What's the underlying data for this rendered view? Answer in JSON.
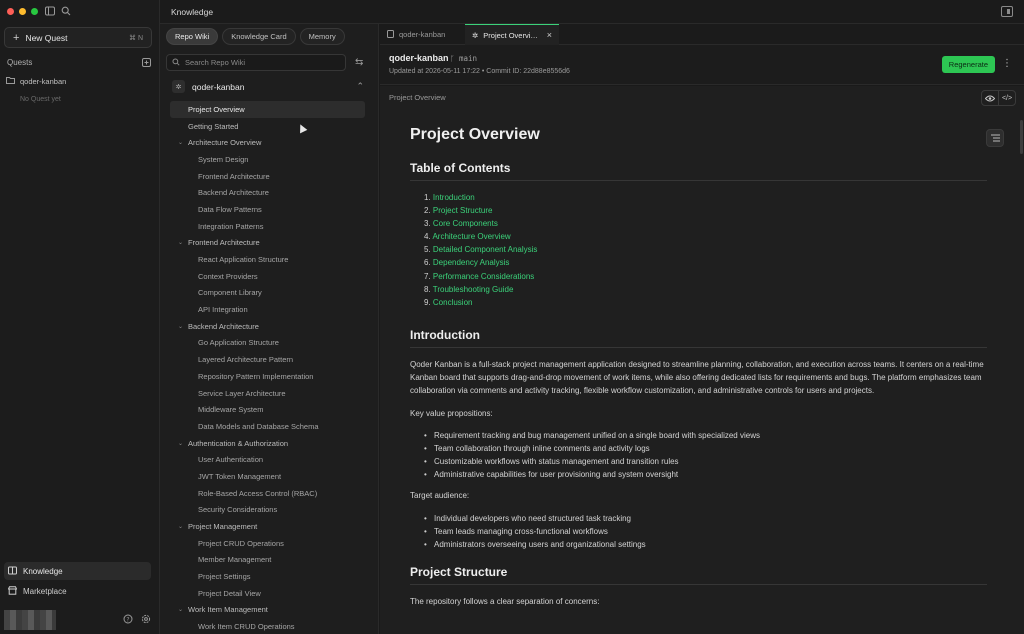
{
  "colors": {
    "accent": "#3bd27a",
    "regenerate_bg": "#2dc653",
    "traffic_red": "#fe5f57",
    "traffic_yellow": "#febc2e",
    "traffic_green": "#28c840"
  },
  "left_sidebar": {
    "new_quest": {
      "label": "New Quest",
      "shortcut": "⌘ N"
    },
    "quests_title": "Quests",
    "quest_items": [
      {
        "label": "qoder-kanban"
      }
    ],
    "empty_text": "No Quest yet",
    "bottom_nav": [
      {
        "label": "Knowledge",
        "icon": "book-icon"
      },
      {
        "label": "Marketplace",
        "icon": "store-icon"
      }
    ]
  },
  "topbar": {
    "title": "Knowledge"
  },
  "wiki_panel": {
    "tabs": [
      {
        "label": "Repo Wiki"
      },
      {
        "label": "Knowledge Card"
      },
      {
        "label": "Memory"
      }
    ],
    "search_placeholder": "Search Repo Wiki",
    "repo_name": "qoder-kanban",
    "tree": [
      {
        "label": "Project Overview",
        "level": 0,
        "active": true
      },
      {
        "label": "Getting Started",
        "level": 0
      },
      {
        "label": "Architecture Overview",
        "section": true
      },
      {
        "label": "System Design",
        "level": 1
      },
      {
        "label": "Frontend Architecture",
        "level": 1
      },
      {
        "label": "Backend Architecture",
        "level": 1
      },
      {
        "label": "Data Flow Patterns",
        "level": 1
      },
      {
        "label": "Integration Patterns",
        "level": 1
      },
      {
        "label": "Frontend Architecture",
        "section": true
      },
      {
        "label": "React Application Structure",
        "level": 1
      },
      {
        "label": "Context Providers",
        "level": 1
      },
      {
        "label": "Component Library",
        "level": 1
      },
      {
        "label": "API Integration",
        "level": 1
      },
      {
        "label": "Backend Architecture",
        "section": true
      },
      {
        "label": "Go Application Structure",
        "level": 1
      },
      {
        "label": "Layered Architecture Pattern",
        "level": 1
      },
      {
        "label": "Repository Pattern Implementation",
        "level": 1
      },
      {
        "label": "Service Layer Architecture",
        "level": 1
      },
      {
        "label": "Middleware System",
        "level": 1
      },
      {
        "label": "Data Models and Database Schema",
        "level": 1
      },
      {
        "label": "Authentication & Authorization",
        "section": true
      },
      {
        "label": "User Authentication",
        "level": 1
      },
      {
        "label": "JWT Token Management",
        "level": 1
      },
      {
        "label": "Role-Based Access Control (RBAC)",
        "level": 1
      },
      {
        "label": "Security Considerations",
        "level": 1
      },
      {
        "label": "Project Management",
        "section": true
      },
      {
        "label": "Project CRUD Operations",
        "level": 1
      },
      {
        "label": "Member Management",
        "level": 1
      },
      {
        "label": "Project Settings",
        "level": 1
      },
      {
        "label": "Project Detail View",
        "level": 1
      },
      {
        "label": "Work Item Management",
        "section": true
      },
      {
        "label": "Work Item CRUD Operations",
        "level": 1
      }
    ]
  },
  "doc_tabs": [
    {
      "label": "qoder-kanban"
    },
    {
      "label": "Project Overvi…"
    }
  ],
  "doc_header": {
    "repo": "qoder-kanban",
    "branch": "main",
    "meta": "Updated at 2026-05-11 17:22  •  Commit ID: 22d88e8556d6",
    "regenerate_label": "Regenerate"
  },
  "content": {
    "breadcrumb": "Project Overview",
    "title": "Project Overview",
    "toc_heading": "Table of Contents",
    "toc": [
      {
        "num": "1.",
        "label": "Introduction"
      },
      {
        "num": "2.",
        "label": "Project Structure"
      },
      {
        "num": "3.",
        "label": "Core Components"
      },
      {
        "num": "4.",
        "label": "Architecture Overview"
      },
      {
        "num": "5.",
        "label": "Detailed Component Analysis"
      },
      {
        "num": "6.",
        "label": "Dependency Analysis"
      },
      {
        "num": "7.",
        "label": "Performance Considerations"
      },
      {
        "num": "8.",
        "label": "Troubleshooting Guide"
      },
      {
        "num": "9.",
        "label": "Conclusion"
      }
    ],
    "intro_heading": "Introduction",
    "intro_para": "Qoder Kanban is a full-stack project management application designed to streamline planning, collaboration, and execution across teams. It centers on a real-time Kanban board that supports drag-and-drop movement of work items, while also offering dedicated lists for requirements and bugs. The platform emphasizes team collaboration via comments and activity tracking, flexible workflow customization, and administrative controls for users and projects.",
    "key_value_label": "Key value propositions:",
    "key_values": [
      "Requirement tracking and bug management unified on a single board with specialized views",
      "Team collaboration through inline comments and activity logs",
      "Customizable workflows with status management and transition rules",
      "Administrative capabilities for user provisioning and system oversight"
    ],
    "audience_label": "Target audience:",
    "audience": [
      "Individual developers who need structured task tracking",
      "Team leads managing cross-functional workflows",
      "Administrators overseeing users and organizational settings"
    ],
    "structure_heading": "Project Structure",
    "structure_para": "The repository follows a clear separation of concerns:"
  }
}
